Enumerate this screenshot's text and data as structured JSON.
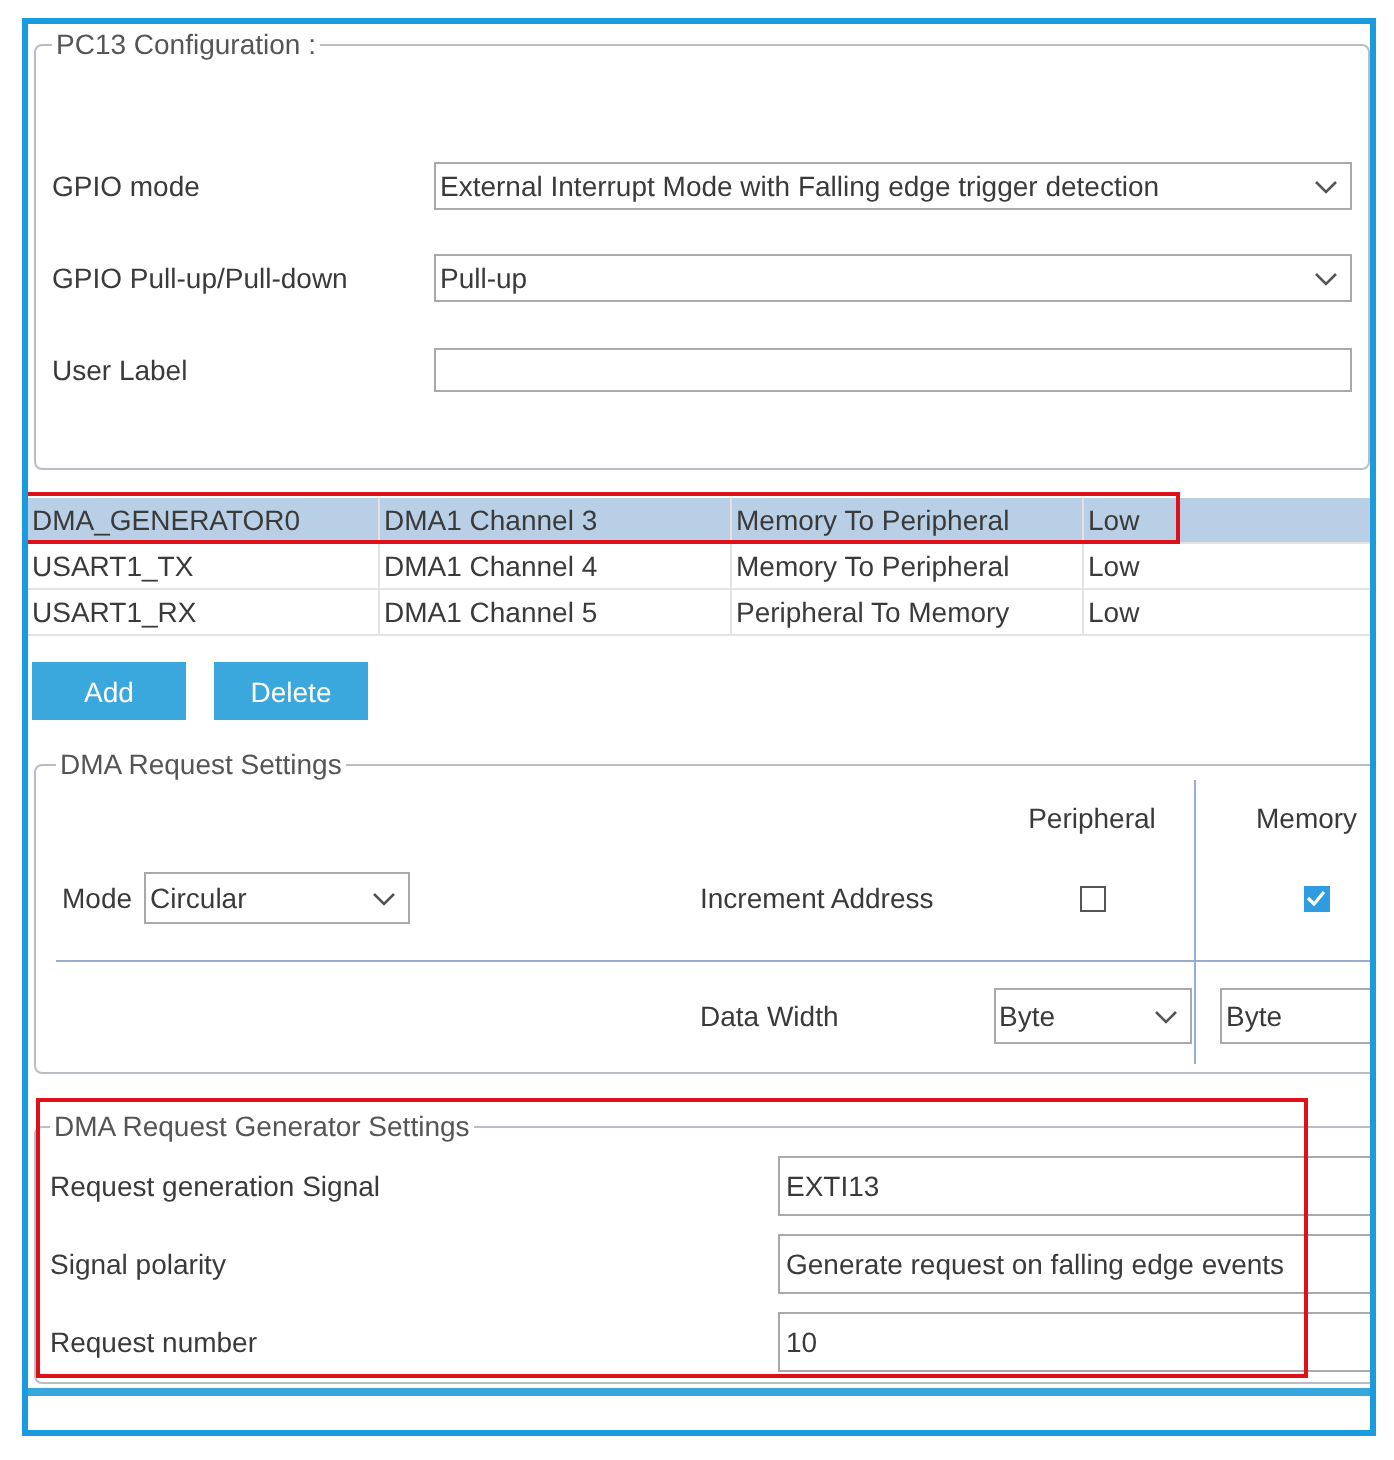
{
  "pin_configuration": {
    "title": "PC13 Configuration :",
    "fields": [
      {
        "label": "GPIO mode",
        "kind": "dropdown",
        "value": "External Interrupt Mode with Falling edge trigger detection"
      },
      {
        "label": "GPIO Pull-up/Pull-down",
        "kind": "dropdown",
        "value": "Pull-up"
      },
      {
        "label": "User Label",
        "kind": "text"
      }
    ]
  },
  "dma_table": {
    "rows": [
      {
        "column_1": "DMA_GENERATOR0",
        "column_2": "DMA1 Channel 3",
        "column_3": "Memory To Peripheral",
        "column_4": "Low",
        "selected": true,
        "highlighted": true
      },
      {
        "column_1": "USART1_TX",
        "column_2": "DMA1 Channel 4",
        "column_3": "Memory To Peripheral",
        "column_4": "Low",
        "selected": false,
        "highlighted": false
      },
      {
        "column_1": "USART1_RX",
        "column_2": "DMA1 Channel 5",
        "column_3": "Peripheral To Memory",
        "column_4": "Low",
        "selected": false,
        "highlighted": false
      }
    ]
  },
  "buttons": [
    "Add",
    "Delete"
  ],
  "request_settings": {
    "title": "DMA Request Settings",
    "mode_label": "Mode",
    "mode": "Circular",
    "columns": [
      "Peripheral",
      "Memory"
    ],
    "increment_label": "Increment Address",
    "increment": [
      {
        "checked": false
      },
      {
        "checked": true
      }
    ],
    "width_label": "Data Width",
    "widths": [
      "Byte",
      "Byte"
    ]
  },
  "generator_settings": {
    "title": "DMA Request Generator Settings",
    "highlighted": true,
    "fields": [
      {
        "label": "Request generation Signal",
        "value": "EXTI13"
      },
      {
        "label": "Signal polarity",
        "value": "Generate request on falling edge events"
      },
      {
        "label": "Request number",
        "value": "10"
      }
    ]
  }
}
